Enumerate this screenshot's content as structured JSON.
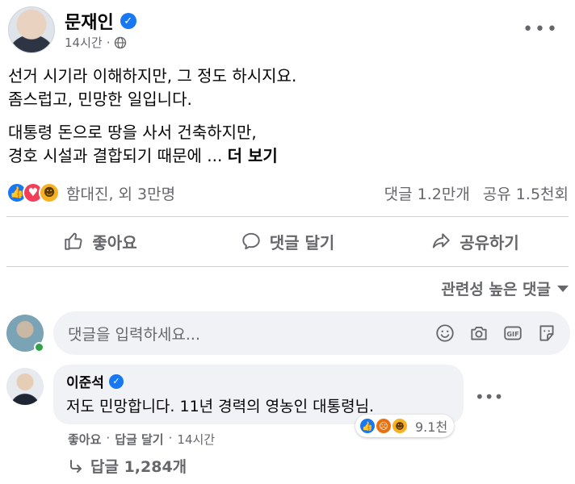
{
  "post": {
    "author": "문재인",
    "time": "14시간",
    "separator": "·",
    "more": "•••",
    "paragraphs": [
      "선거 시기라 이해하지만, 그 정도 하시지요.\n좀스럽고, 민망한 일입니다.",
      "대통령 돈으로 땅을 사서 건축하지만,\n경호 시설과 결합되기 때문에 ... "
    ],
    "see_more": "더 보기"
  },
  "reactions": {
    "icons": [
      "like-reaction-icon",
      "love-reaction-icon",
      "haha-reaction-icon"
    ],
    "names": "함대진, 외 3만명",
    "comments_count": "댓글 1.2만개",
    "shares_count": "공유 1.5천회"
  },
  "actions": {
    "like": "좋아요",
    "comment": "댓글 달기",
    "share": "공유하기"
  },
  "sort": {
    "label": "관련성 높은 댓글"
  },
  "comment_input": {
    "placeholder": "댓글을 입력하세요..."
  },
  "comment": {
    "author": "이준석",
    "text": "저도 민망합니다. 11년 경력의 영농인 대통령님.",
    "reaction_count": "9.1천",
    "like_label": "좋아요",
    "reply_label": "답글 달기",
    "time": "14시간",
    "replies": "답글 1,284개",
    "more": "•••"
  },
  "colors": {
    "accent": "#1877f2",
    "secondary_text": "#65676b",
    "bubble": "#f0f2f5"
  }
}
